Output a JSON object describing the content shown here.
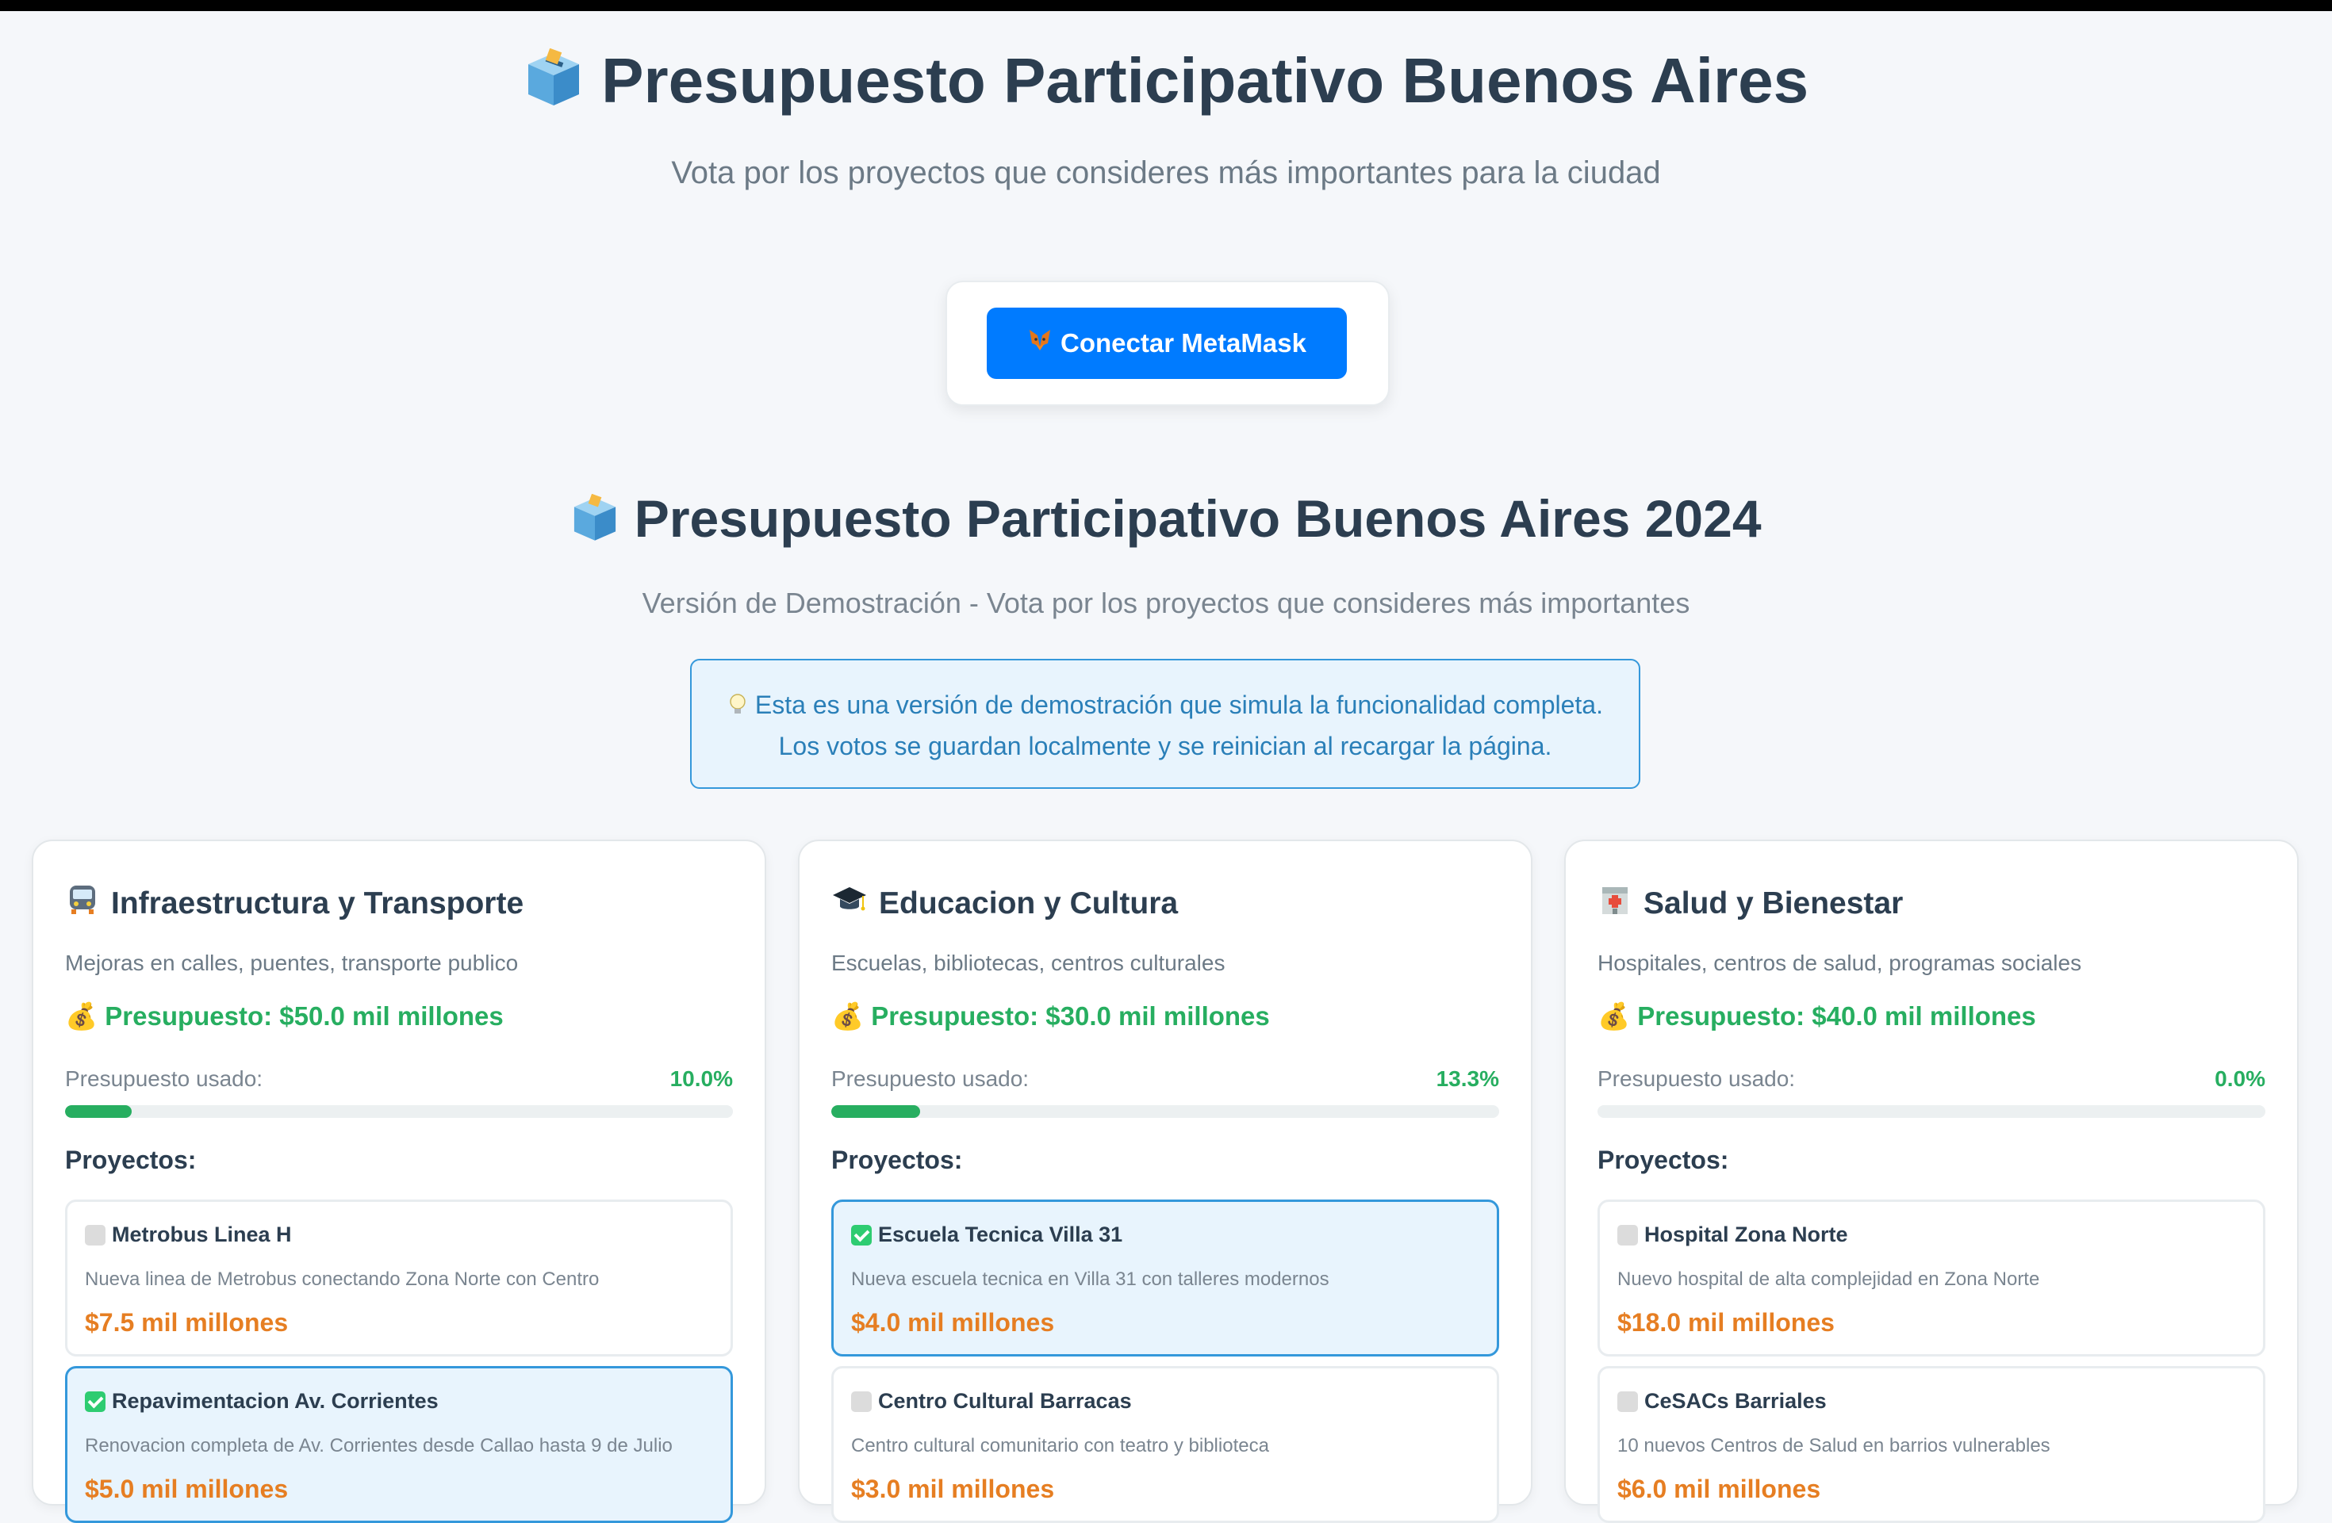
{
  "header": {
    "title": "Presupuesto Participativo Buenos Aires",
    "subtitle": "Vota por los proyectos que consideres más importantes para la ciudad",
    "ballot_icon": "ballot-box-icon"
  },
  "wallet": {
    "connect_label": "Conectar MetaMask",
    "icon": "fox-icon"
  },
  "demo": {
    "title": "Presupuesto Participativo Buenos Aires 2024",
    "subtitle": "Versión de Demostración - Vota por los proyectos que consideres más importantes",
    "info_line1": "Esta es una versión de demostración que simula la funcionalidad completa.",
    "info_line2": "Los votos se guardan localmente y se reinician al recargar la página.",
    "info_icon": "lightbulb-icon"
  },
  "labels": {
    "budget_used": "Presupuesto usado:",
    "projects": "Proyectos:"
  },
  "colors": {
    "accent": "#007bff",
    "success": "#27ae60",
    "cost": "#e67e22",
    "selected_border": "#3498db"
  },
  "categories": [
    {
      "icon": "train-icon",
      "name": "Infraestructura y Transporte",
      "description": "Mejoras en calles, puentes, transporte publico",
      "budget": "💰 Presupuesto: $50.0 mil millones",
      "used_pct_label": "10.0%",
      "used_fraction": 0.1,
      "projects": [
        {
          "selected": false,
          "name": "Metrobus Linea H",
          "description": "Nueva linea de Metrobus conectando Zona Norte con Centro",
          "cost": "$7.5 mil millones"
        },
        {
          "selected": true,
          "name": "Repavimentacion Av. Corrientes",
          "description": "Renovacion completa de Av. Corrientes desde Callao hasta 9 de Julio",
          "cost": "$5.0 mil millones"
        }
      ]
    },
    {
      "icon": "graduation-cap-icon",
      "name": "Educacion y Cultura",
      "description": "Escuelas, bibliotecas, centros culturales",
      "budget": "💰 Presupuesto: $30.0 mil millones",
      "used_pct_label": "13.3%",
      "used_fraction": 0.133,
      "projects": [
        {
          "selected": true,
          "name": "Escuela Tecnica Villa 31",
          "description": "Nueva escuela tecnica en Villa 31 con talleres modernos",
          "cost": "$4.0 mil millones"
        },
        {
          "selected": false,
          "name": "Centro Cultural Barracas",
          "description": "Centro cultural comunitario con teatro y biblioteca",
          "cost": "$3.0 mil millones"
        }
      ]
    },
    {
      "icon": "hospital-icon",
      "name": "Salud y Bienestar",
      "description": "Hospitales, centros de salud, programas sociales",
      "budget": "💰 Presupuesto: $40.0 mil millones",
      "used_pct_label": "0.0%",
      "used_fraction": 0.0,
      "projects": [
        {
          "selected": false,
          "name": "Hospital Zona Norte",
          "description": "Nuevo hospital de alta complejidad en Zona Norte",
          "cost": "$18.0 mil millones"
        },
        {
          "selected": false,
          "name": "CeSACs Barriales",
          "description": "10 nuevos Centros de Salud en barrios vulnerables",
          "cost": "$6.0 mil millones"
        }
      ]
    }
  ]
}
